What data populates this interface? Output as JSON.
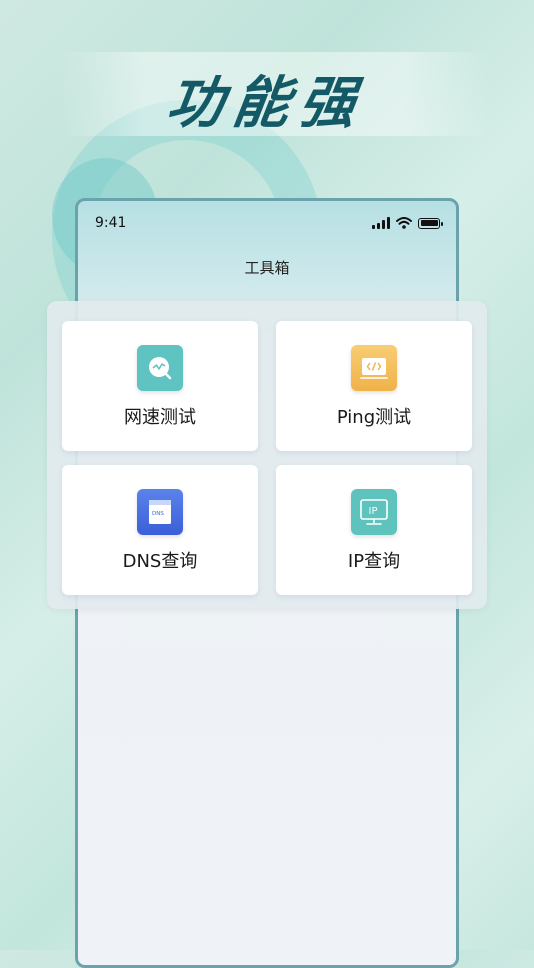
{
  "headline": "功能强",
  "status_bar": {
    "time": "9:41"
  },
  "page": {
    "title": "工具箱"
  },
  "tools": [
    {
      "label": "网速测试",
      "icon": "speed-test-icon",
      "color": "#5ec3c1"
    },
    {
      "label": "Ping测试",
      "icon": "code-terminal-icon",
      "color": "#f3bb55"
    },
    {
      "label": "DNS查询",
      "icon": "dns-icon",
      "color": "#4a70e0"
    },
    {
      "label": "IP查询",
      "icon": "ip-monitor-icon",
      "color": "#5ec3bd"
    }
  ],
  "dns_icon_text": "DNS",
  "ip_icon_text": "IP",
  "colors": {
    "headline": "#145a66",
    "phone_border": "#6aa3ab"
  }
}
